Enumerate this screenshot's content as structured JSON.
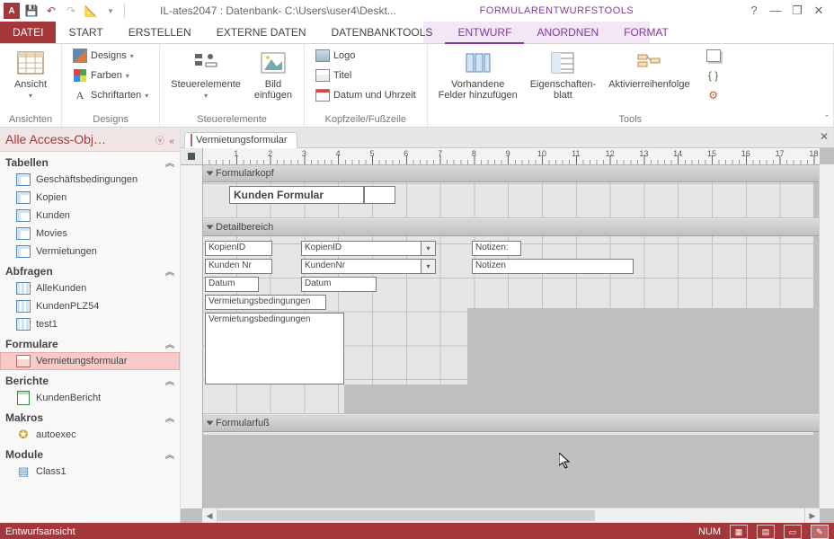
{
  "title": "IL-ates2047 : Datenbank- C:\\Users\\user4\\Deskt...",
  "contextual_title": "FORMULARENTWURFSTOOLS",
  "tabs": {
    "file": "DATEI",
    "start": "START",
    "erstellen": "ERSTELLEN",
    "externe": "EXTERNE DATEN",
    "dbtools": "DATENBANKTOOLS",
    "entwurf": "ENTWURF",
    "anordnen": "ANORDNEN",
    "format": "FORMAT"
  },
  "ribbon": {
    "ansicht": "Ansicht",
    "ansichten": "Ansichten",
    "designs_btn": "Designs",
    "farben_btn": "Farben",
    "schriftarten_btn": "Schriftarten",
    "designs_group": "Designs",
    "steuerelemente_btn": "Steuerelemente",
    "bild": "Bild\neinfügen",
    "steuerelemente_group": "Steuerelemente",
    "logo": "Logo",
    "titel": "Titel",
    "datum": "Datum und Uhrzeit",
    "kopfzeile_group": "Kopfzeile/Fußzeile",
    "vorhandene": "Vorhandene\nFelder hinzufügen",
    "eigenschaften": "Eigenschaften-\nblatt",
    "aktivier": "Aktivierreihenfolge",
    "tools_group": "Tools"
  },
  "navpane": {
    "header": "Alle Access-Obj…",
    "tabellen": "Tabellen",
    "t_items": [
      "Geschäftsbedingungen",
      "Kopien",
      "Kunden",
      "Movies",
      "Vermietungen"
    ],
    "abfragen": "Abfragen",
    "q_items": [
      "AlleKunden",
      "KundenPLZ54",
      "test1"
    ],
    "formulare": "Formulare",
    "f_items": [
      "Vermietungsformular"
    ],
    "berichte": "Berichte",
    "r_items": [
      "KundenBericht"
    ],
    "makros": "Makros",
    "m_items": [
      "autoexec"
    ],
    "module": "Module",
    "mo_items": [
      "Class1"
    ]
  },
  "doc_tab": "Vermietungsformular",
  "sections": {
    "formkopf": "Formularkopf",
    "detail": "Detailbereich",
    "formfuss": "Formularfuß"
  },
  "form_title": "Kunden Formular",
  "fields": {
    "kopienid_lbl": "KopienID",
    "kopienid_src": "KopienID",
    "kundennr_lbl": "Kunden Nr",
    "kundennr_src": "KundenNr",
    "datum_lbl": "Datum",
    "datum_src": "Datum",
    "verm_lbl": "Vermietungsbedingungen",
    "verm_src": "Vermietungsbedingungen",
    "notizen_lbl": "Notizen:",
    "notizen_src": "Notizen"
  },
  "statusbar": {
    "left": "Entwurfsansicht",
    "num": "NUM"
  }
}
